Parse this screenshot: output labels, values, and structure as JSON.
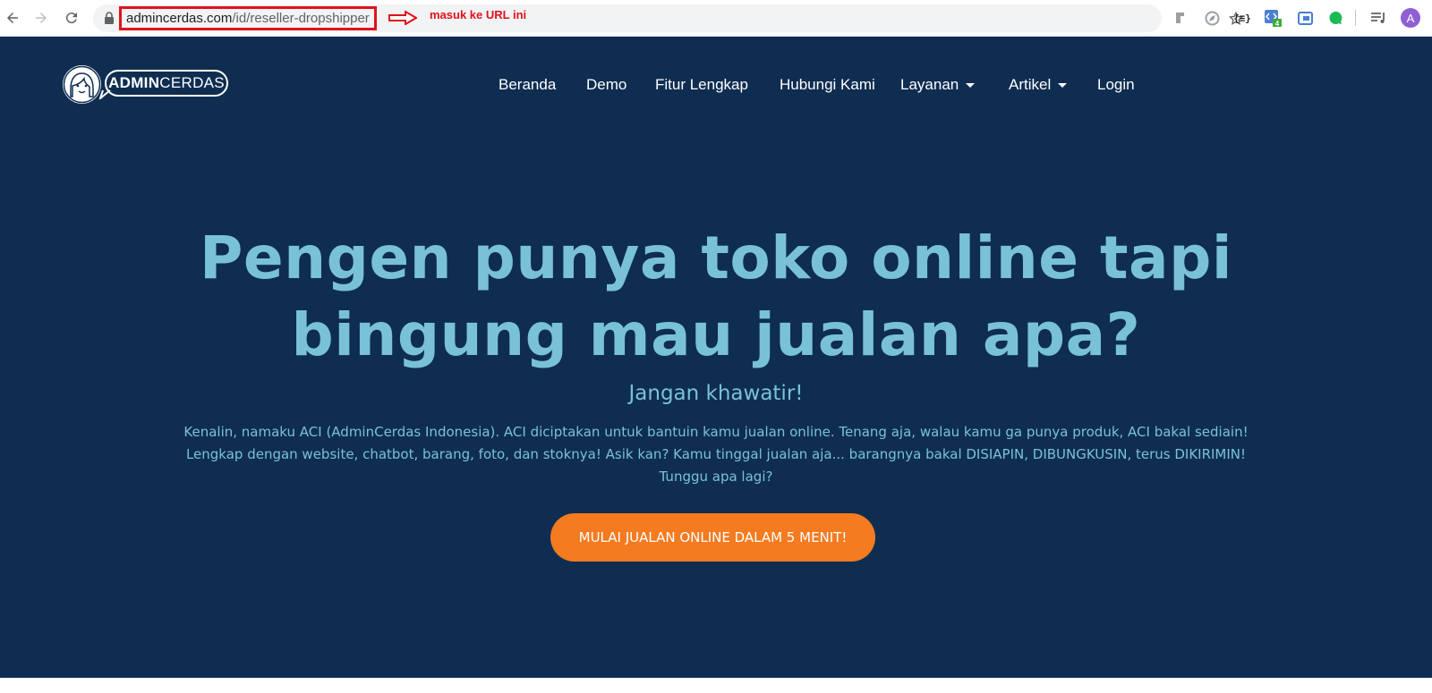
{
  "browser": {
    "url_domain": "admincerdas.com",
    "url_path": "/id/reseller-dropshipper",
    "annotation": "masuk ke URL ini",
    "profile_initial": "A",
    "extensions": [
      {
        "name": "puzzle-extension-icon",
        "color": "#9aa0a6"
      },
      {
        "name": "compass-extension-icon",
        "color": "#9aa0a6"
      },
      {
        "name": "json-extension-icon",
        "color": "#202124"
      },
      {
        "name": "code-extension-icon",
        "color": "#4a7fd4",
        "badge": "4"
      },
      {
        "name": "calendar-extension-icon",
        "color": "#4a7fd4"
      },
      {
        "name": "chat-extension-icon",
        "color": "#1db954"
      },
      {
        "name": "media-control-icon",
        "color": "#5f6368"
      }
    ]
  },
  "logo": {
    "bold": "ADMIN",
    "rest": "CERDAS"
  },
  "nav": {
    "items": [
      {
        "label": "Beranda",
        "dropdown": false
      },
      {
        "label": "Demo",
        "dropdown": false
      },
      {
        "label": "Fitur Lengkap",
        "dropdown": false
      },
      {
        "label": "Hubungi Kami",
        "dropdown": false
      },
      {
        "label": "Layanan",
        "dropdown": true
      },
      {
        "label": "Artikel",
        "dropdown": true
      },
      {
        "label": "Login",
        "dropdown": false
      }
    ]
  },
  "hero": {
    "headline_line1": "Pengen punya toko online tapi",
    "headline_line2": "bingung mau jualan apa?",
    "subhead": "Jangan khawatir!",
    "body_line1": "Kenalin, namaku ACI (AdminCerdas Indonesia). ACI diciptakan untuk bantuin kamu jualan online. Tenang aja, walau kamu ga punya produk, ACI bakal sediain!",
    "body_line2": "Lengkap dengan website, chatbot, barang, foto, dan stoknya! Asik kan? Kamu tinggal jualan aja... barangnya bakal DISIAPIN, DIBUNGKUSIN, terus DIKIRIMIN!",
    "body_line3": "Tunggu apa lagi?",
    "cta_label": "MULAI JUALAN ONLINE DALAM 5 MENIT!"
  },
  "colors": {
    "hero_bg": "#0f2d51",
    "accent_text": "#79c1d6",
    "cta": "#f47b20",
    "annotation": "#e0121b"
  }
}
